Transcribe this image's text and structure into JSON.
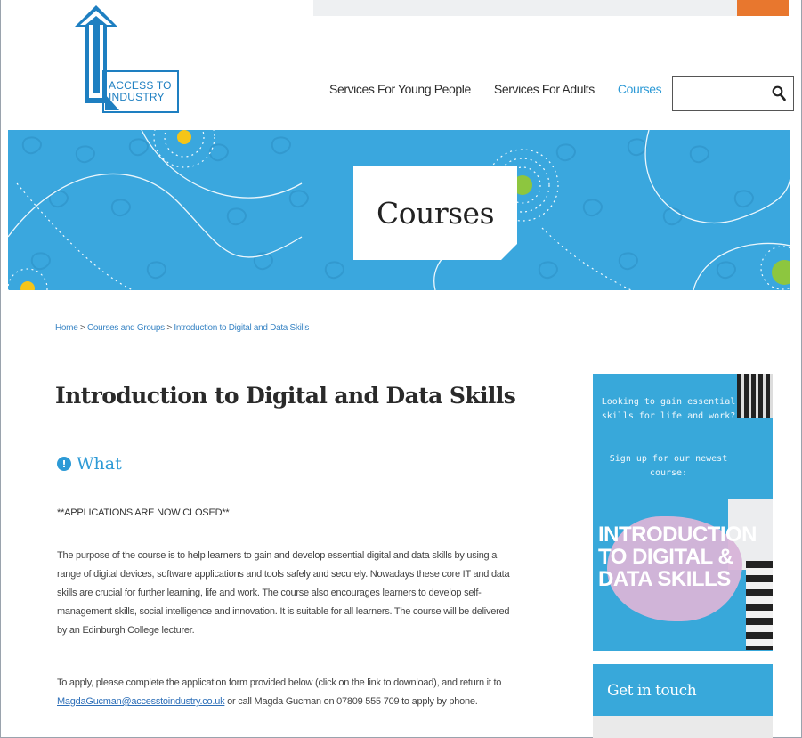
{
  "logo": {
    "line1": "ACCESS TO",
    "line2": "INDUSTRY"
  },
  "nav": {
    "items": [
      {
        "label": "Services For Young People"
      },
      {
        "label": "Services For Adults"
      },
      {
        "label": "Courses",
        "active": true
      }
    ],
    "search_icon": "magnifier-icon"
  },
  "banner": {
    "title": "Courses"
  },
  "breadcrumb": {
    "home": "Home",
    "sep": " > ",
    "courses_groups": "Courses and Groups",
    "current": "Introduction to Digital and Data Skills"
  },
  "main": {
    "title": "Introduction to Digital and Data Skills",
    "section_label": "What",
    "closed_notice": "**APPLICATIONS ARE NOW CLOSED**",
    "para1": "The purpose of the course is to help learners to gain and develop essential digital and data skills by using a range of digital devices, software applications and tools safely and securely. Nowadays these core IT and data skills are crucial for further learning, life and work. The course also encourages learners to develop self-management skills, social intelligence and innovation. It is suitable for all learners. The course will be delivered by an Edinburgh College lecturer.",
    "para2_before": "To apply, please complete the application form provided below (click on the link to download), and return it to ",
    "para2_email": "MagdaGucman@accesstoindustry.co.uk",
    "para2_after": " or call Magda Gucman on 07809 555 709 to apply by phone."
  },
  "sidebar": {
    "promo_question": "Looking to gain essential skills for life and work?",
    "promo_signup": "Sign up for our newest course:",
    "promo_big": "INTRODUCTION TO DIGITAL & DATA SKILLS",
    "touch_label": "Get in touch"
  },
  "colors": {
    "accent": "#2d9ad6",
    "banner": "#3aa7de",
    "orange": "#e8772e",
    "green": "#8dc63f",
    "yellow": "#f5c518"
  }
}
